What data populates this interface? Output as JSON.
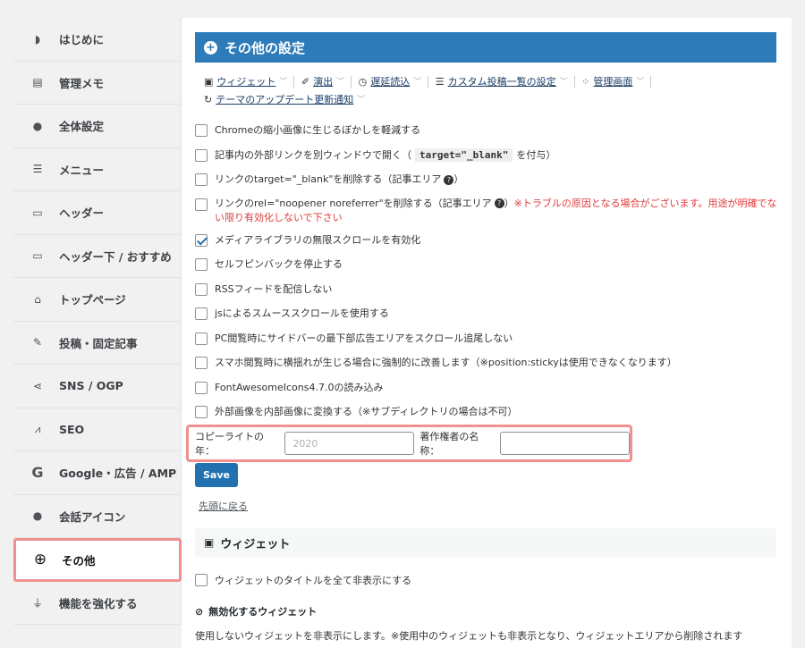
{
  "sidebar": {
    "items": [
      {
        "label": "はじめに",
        "icon": "shield-icon",
        "glyph": "◗"
      },
      {
        "label": "管理メモ",
        "icon": "note-icon",
        "glyph": "▤"
      },
      {
        "label": "全体設定",
        "icon": "palette-icon",
        "glyph": "●"
      },
      {
        "label": "メニュー",
        "icon": "menu-icon",
        "glyph": "☰"
      },
      {
        "label": "ヘッダー",
        "icon": "header-icon",
        "glyph": "▭"
      },
      {
        "label": "ヘッダー下 / おすすめ",
        "icon": "header-below-icon",
        "glyph": "▭"
      },
      {
        "label": "トップページ",
        "icon": "home-icon",
        "glyph": "⌂"
      },
      {
        "label": "投稿・固定記事",
        "icon": "edit-icon",
        "glyph": "✎"
      },
      {
        "label": "SNS / OGP",
        "icon": "share-icon",
        "glyph": "⋖"
      },
      {
        "label": "SEO",
        "icon": "chart-icon",
        "glyph": "⩘"
      },
      {
        "label": "Google・広告 / AMP",
        "icon": "google-icon",
        "glyph": "G"
      },
      {
        "label": "会話アイコン",
        "icon": "chat-icon",
        "glyph": "●"
      },
      {
        "label": "その他",
        "icon": "plus-circle-icon",
        "glyph": "⊕"
      },
      {
        "label": "機能を強化する",
        "icon": "plug-icon",
        "glyph": "⏚"
      }
    ],
    "active_index": 12
  },
  "main": {
    "title": "その他の設定",
    "tabs": [
      {
        "label": "ウィジェット",
        "icon": "widget-icon",
        "glyph": "▣"
      },
      {
        "label": "演出",
        "icon": "pen-icon",
        "glyph": "✐"
      },
      {
        "label": "遅延読込",
        "icon": "clock-icon",
        "glyph": "◷"
      },
      {
        "label": "カスタム投稿一覧の設定",
        "icon": "list-icon",
        "glyph": "☰"
      },
      {
        "label": "管理画面",
        "icon": "admin-icon",
        "glyph": "⁘"
      },
      {
        "label": "テーマのアップデート更新通知",
        "icon": "refresh-icon",
        "glyph": "↻"
      }
    ],
    "options": {
      "o1": {
        "text": "Chromeの縮小画像に生じるぼかしを軽減する",
        "checked": false
      },
      "o2": {
        "before": "記事内の外部リンクを別ウィンドウで開く（",
        "code": "target=\"_blank\"",
        "after": "を付与）",
        "checked": false
      },
      "o3": {
        "text": "リンクのtarget=\"_blank\"を削除する（記事エリア",
        "after": "）",
        "checked": false
      },
      "o4": {
        "text": "リンクのrel=\"noopener noreferrer\"を削除する（記事エリア",
        "after": "）",
        "warning": "※トラブルの原因となる場合がございます。用途が明確でない限り有効化しないで下さい",
        "checked": false
      },
      "o5": {
        "text": "メディアライブラリの無限スクロールを有効化",
        "checked": true
      },
      "o6": {
        "text": "セルフピンバックを停止する",
        "checked": false
      },
      "o7": {
        "text": "RSSフィードを配信しない",
        "checked": false
      },
      "o8": {
        "text": "jsによるスムーススクロールを使用する",
        "checked": false
      },
      "o9": {
        "text": "PC閲覧時にサイドバーの最下部広告エリアをスクロール追尾しない",
        "checked": false
      },
      "o10": {
        "text": "スマホ閲覧時に横揺れが生じる場合に強制的に改善します（※position:stickyは使用できなくなります）",
        "checked": false
      },
      "o11": {
        "text": "FontAwesomeIcons4.7.0の読み込み",
        "checked": false
      },
      "o12": {
        "text": "外部画像を内部画像に変換する（※サブディレクトリの場合は不可）",
        "checked": false
      }
    },
    "copyright": {
      "year_label": "コピーライトの年：",
      "year_placeholder": "2020",
      "year_value": "",
      "author_label": "著作権者の名称：",
      "author_value": ""
    },
    "save_label": "Save",
    "back_link": "先頭に戻る",
    "widget_section": {
      "title": "ウィジェット",
      "option": "ウィジェットのタイトルを全て非表示にする",
      "subheading": "無効化するウィジェット",
      "description": "使用しないウィジェットを非表示にします。※使用中のウィジェットも非表示となり、ウィジェットエリアから削除されます"
    }
  },
  "colors": {
    "accent": "#2d7bb8",
    "button": "#2271b1",
    "highlight": "#f09090",
    "warning": "#e03b3b"
  }
}
